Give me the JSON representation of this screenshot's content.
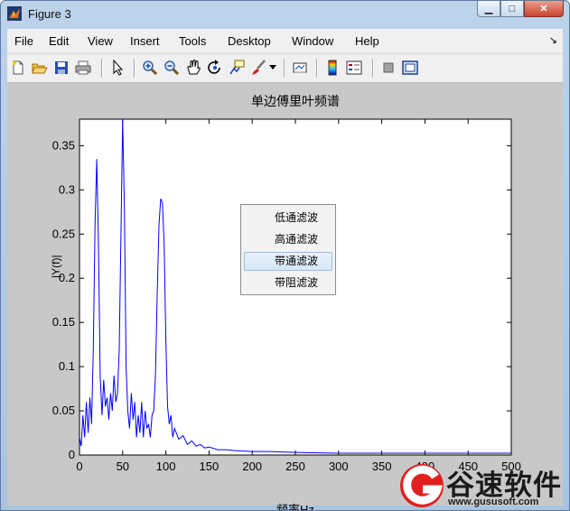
{
  "window": {
    "title": "Figure 3",
    "min_glyph": "▁",
    "max_glyph": "□",
    "close_glyph": "✕"
  },
  "menu": [
    "File",
    "Edit",
    "View",
    "Insert",
    "Tools",
    "Desktop",
    "Window",
    "Help"
  ],
  "toolbar_icons": [
    "new-file-icon",
    "open-folder-icon",
    "save-icon",
    "print-icon",
    "pointer-icon",
    "zoom-in-icon",
    "zoom-out-icon",
    "pan-hand-icon",
    "rotate-3d-icon",
    "data-cursor-icon",
    "brush-icon",
    "brush-dropdown-icon",
    "link-plot-icon",
    "colorbar-icon",
    "legend-icon",
    "hide-plot-tools-icon",
    "show-plot-tools-icon"
  ],
  "plot": {
    "title": "单边傅里叶频谱",
    "xlabel": "频率Hz",
    "ylabel": "|Y(f)|"
  },
  "popup": {
    "items": [
      "低通滤波",
      "高通滤波",
      "带通滤波",
      "带阻滤波"
    ],
    "selected_index": 2
  },
  "watermark": {
    "brand": "谷速软件",
    "url": "www.gususoft.com"
  },
  "colors": {
    "line": "#0000ff",
    "figure_bg": "#c8c8c8",
    "axes_bg": "#ffffff",
    "brand_red": "#e02020"
  },
  "chart_data": {
    "type": "line",
    "title": "单边傅里叶频谱",
    "xlabel": "频率Hz",
    "ylabel": "|Y(f)|",
    "xlim": [
      0,
      500
    ],
    "ylim": [
      0,
      0.38
    ],
    "xticks": [
      0,
      50,
      100,
      150,
      200,
      250,
      300,
      350,
      400,
      450,
      500
    ],
    "yticks": [
      0,
      0.05,
      0.1,
      0.15,
      0.2,
      0.25,
      0.3,
      0.35
    ],
    "grid": false,
    "series": [
      {
        "color": "#0000ff",
        "peaks": [
          {
            "x": 20,
            "y": 0.335
          },
          {
            "x": 50,
            "y": 0.38
          },
          {
            "x": 100,
            "y": 0.29
          }
        ],
        "x": [
          0,
          2,
          4,
          6,
          8,
          10,
          12,
          14,
          16,
          18,
          20,
          22,
          24,
          26,
          28,
          30,
          32,
          34,
          36,
          38,
          40,
          42,
          44,
          46,
          48,
          50,
          52,
          54,
          56,
          58,
          60,
          62,
          64,
          66,
          68,
          70,
          72,
          74,
          76,
          78,
          80,
          82,
          84,
          86,
          88,
          90,
          92,
          94,
          96,
          98,
          100,
          102,
          104,
          106,
          108,
          110,
          115,
          120,
          125,
          130,
          135,
          140,
          145,
          150,
          160,
          170,
          180,
          200,
          220,
          250,
          300,
          350,
          400,
          450,
          500
        ],
        "y": [
          0.02,
          0.01,
          0.045,
          0.02,
          0.06,
          0.025,
          0.065,
          0.035,
          0.12,
          0.26,
          0.335,
          0.24,
          0.09,
          0.045,
          0.085,
          0.055,
          0.065,
          0.04,
          0.07,
          0.05,
          0.09,
          0.06,
          0.07,
          0.12,
          0.25,
          0.38,
          0.28,
          0.1,
          0.05,
          0.03,
          0.07,
          0.04,
          0.06,
          0.02,
          0.045,
          0.025,
          0.06,
          0.02,
          0.05,
          0.03,
          0.035,
          0.02,
          0.045,
          0.05,
          0.09,
          0.18,
          0.26,
          0.29,
          0.285,
          0.24,
          0.13,
          0.055,
          0.035,
          0.045,
          0.02,
          0.03,
          0.018,
          0.022,
          0.012,
          0.016,
          0.01,
          0.012,
          0.008,
          0.009,
          0.006,
          0.006,
          0.005,
          0.004,
          0.004,
          0.003,
          0.002,
          0.002,
          0.002,
          0.002,
          0.002
        ]
      }
    ]
  }
}
